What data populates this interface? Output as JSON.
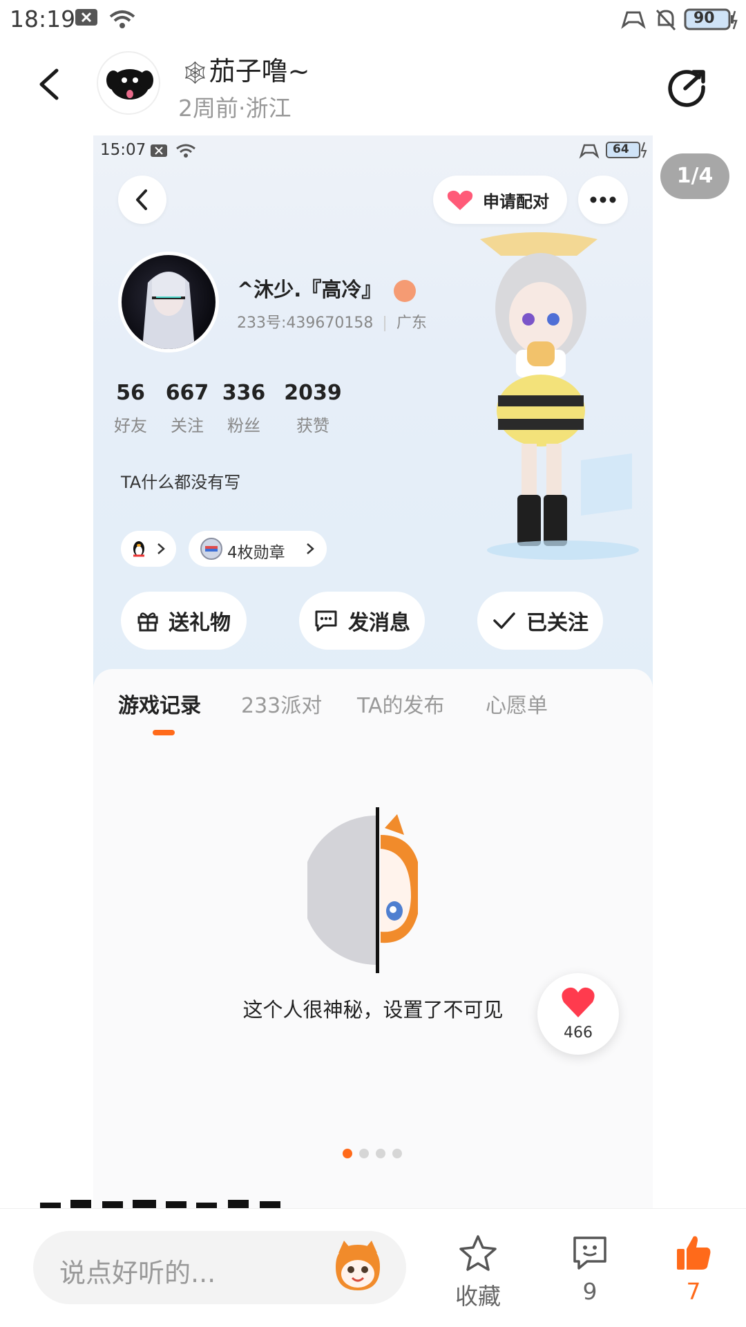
{
  "status_bar": {
    "time": "18:19",
    "battery": "90"
  },
  "header": {
    "author_name": "茄子噜~",
    "author_meta": "2周前·浙江",
    "page_counter": "1/4"
  },
  "screenshot": {
    "status_time": "15:07",
    "battery": "64",
    "pair_label": "申请配对",
    "profile": {
      "name": "^沐少.『高冷』",
      "id_line": "233号:439670158",
      "region": "广东"
    },
    "stats": [
      {
        "num": "56",
        "label": "好友"
      },
      {
        "num": "667",
        "label": "关注"
      },
      {
        "num": "336",
        "label": "粉丝"
      },
      {
        "num": "2039",
        "label": "获赞"
      }
    ],
    "bio": "TA什么都没有写",
    "badge_chip": "4枚勋章",
    "actions": {
      "gift": "送礼物",
      "message": "发消息",
      "following": "已关注"
    },
    "tabs": [
      "游戏记录",
      "233派对",
      "TA的发布",
      "心愿单"
    ],
    "active_tab": 0,
    "empty_text": "这个人很神秘，设置了不可见"
  },
  "like_float": {
    "count": "466"
  },
  "carousel": {
    "total": 4,
    "active": 1
  },
  "bottom_bar": {
    "comment_placeholder": "说点好听的...",
    "favorite_label": "收藏",
    "comment_count": "9",
    "like_count": "7"
  },
  "colors": {
    "accent": "#ff6a1a",
    "heart": "#ff3b4e"
  }
}
